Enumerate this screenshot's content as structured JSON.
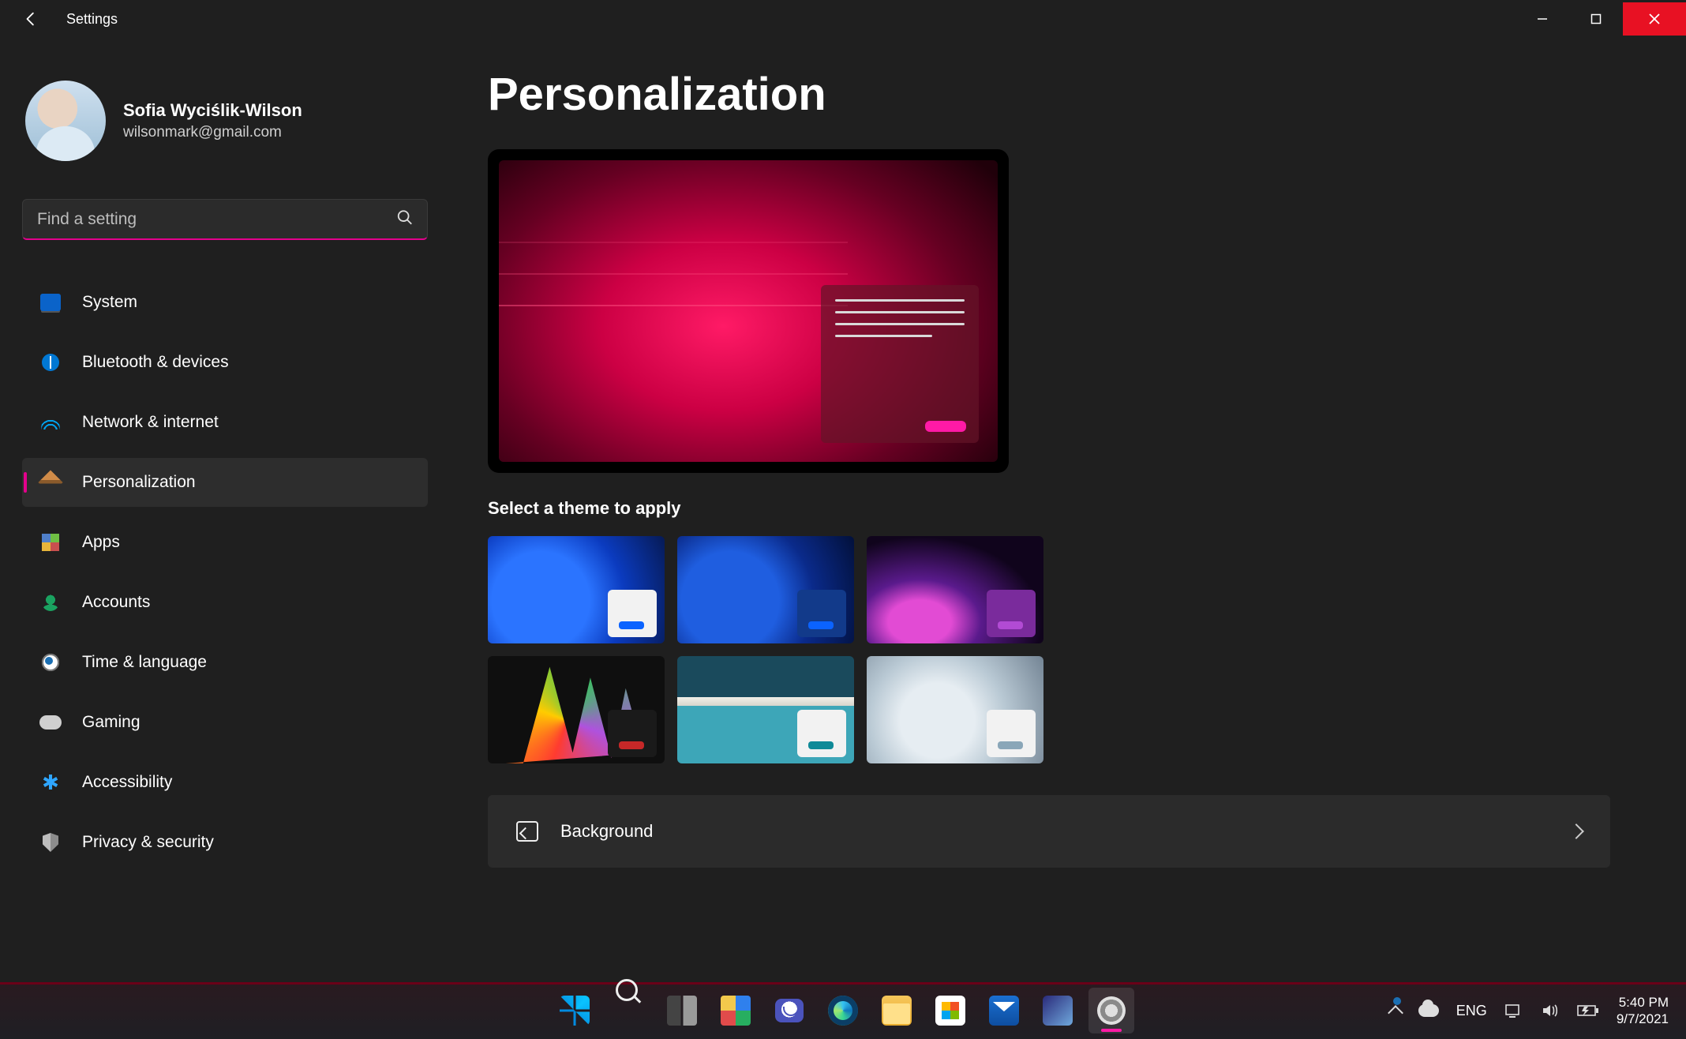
{
  "window": {
    "title": "Settings"
  },
  "user": {
    "name": "Sofia Wyciślik-Wilson",
    "email": "wilsonmark@gmail.com"
  },
  "search": {
    "placeholder": "Find a setting"
  },
  "nav": {
    "items": [
      {
        "label": "System"
      },
      {
        "label": "Bluetooth & devices"
      },
      {
        "label": "Network & internet"
      },
      {
        "label": "Personalization"
      },
      {
        "label": "Apps"
      },
      {
        "label": "Accounts"
      },
      {
        "label": "Time & language"
      },
      {
        "label": "Gaming"
      },
      {
        "label": "Accessibility"
      },
      {
        "label": "Privacy & security"
      }
    ],
    "active_index": 3
  },
  "page": {
    "heading": "Personalization",
    "theme_section_label": "Select a theme to apply",
    "rows": {
      "background": "Background"
    }
  },
  "taskbar": {
    "language": "ENG",
    "time": "5:40 PM",
    "date": "9/7/2021"
  },
  "colors": {
    "accent": "#e3008c"
  }
}
